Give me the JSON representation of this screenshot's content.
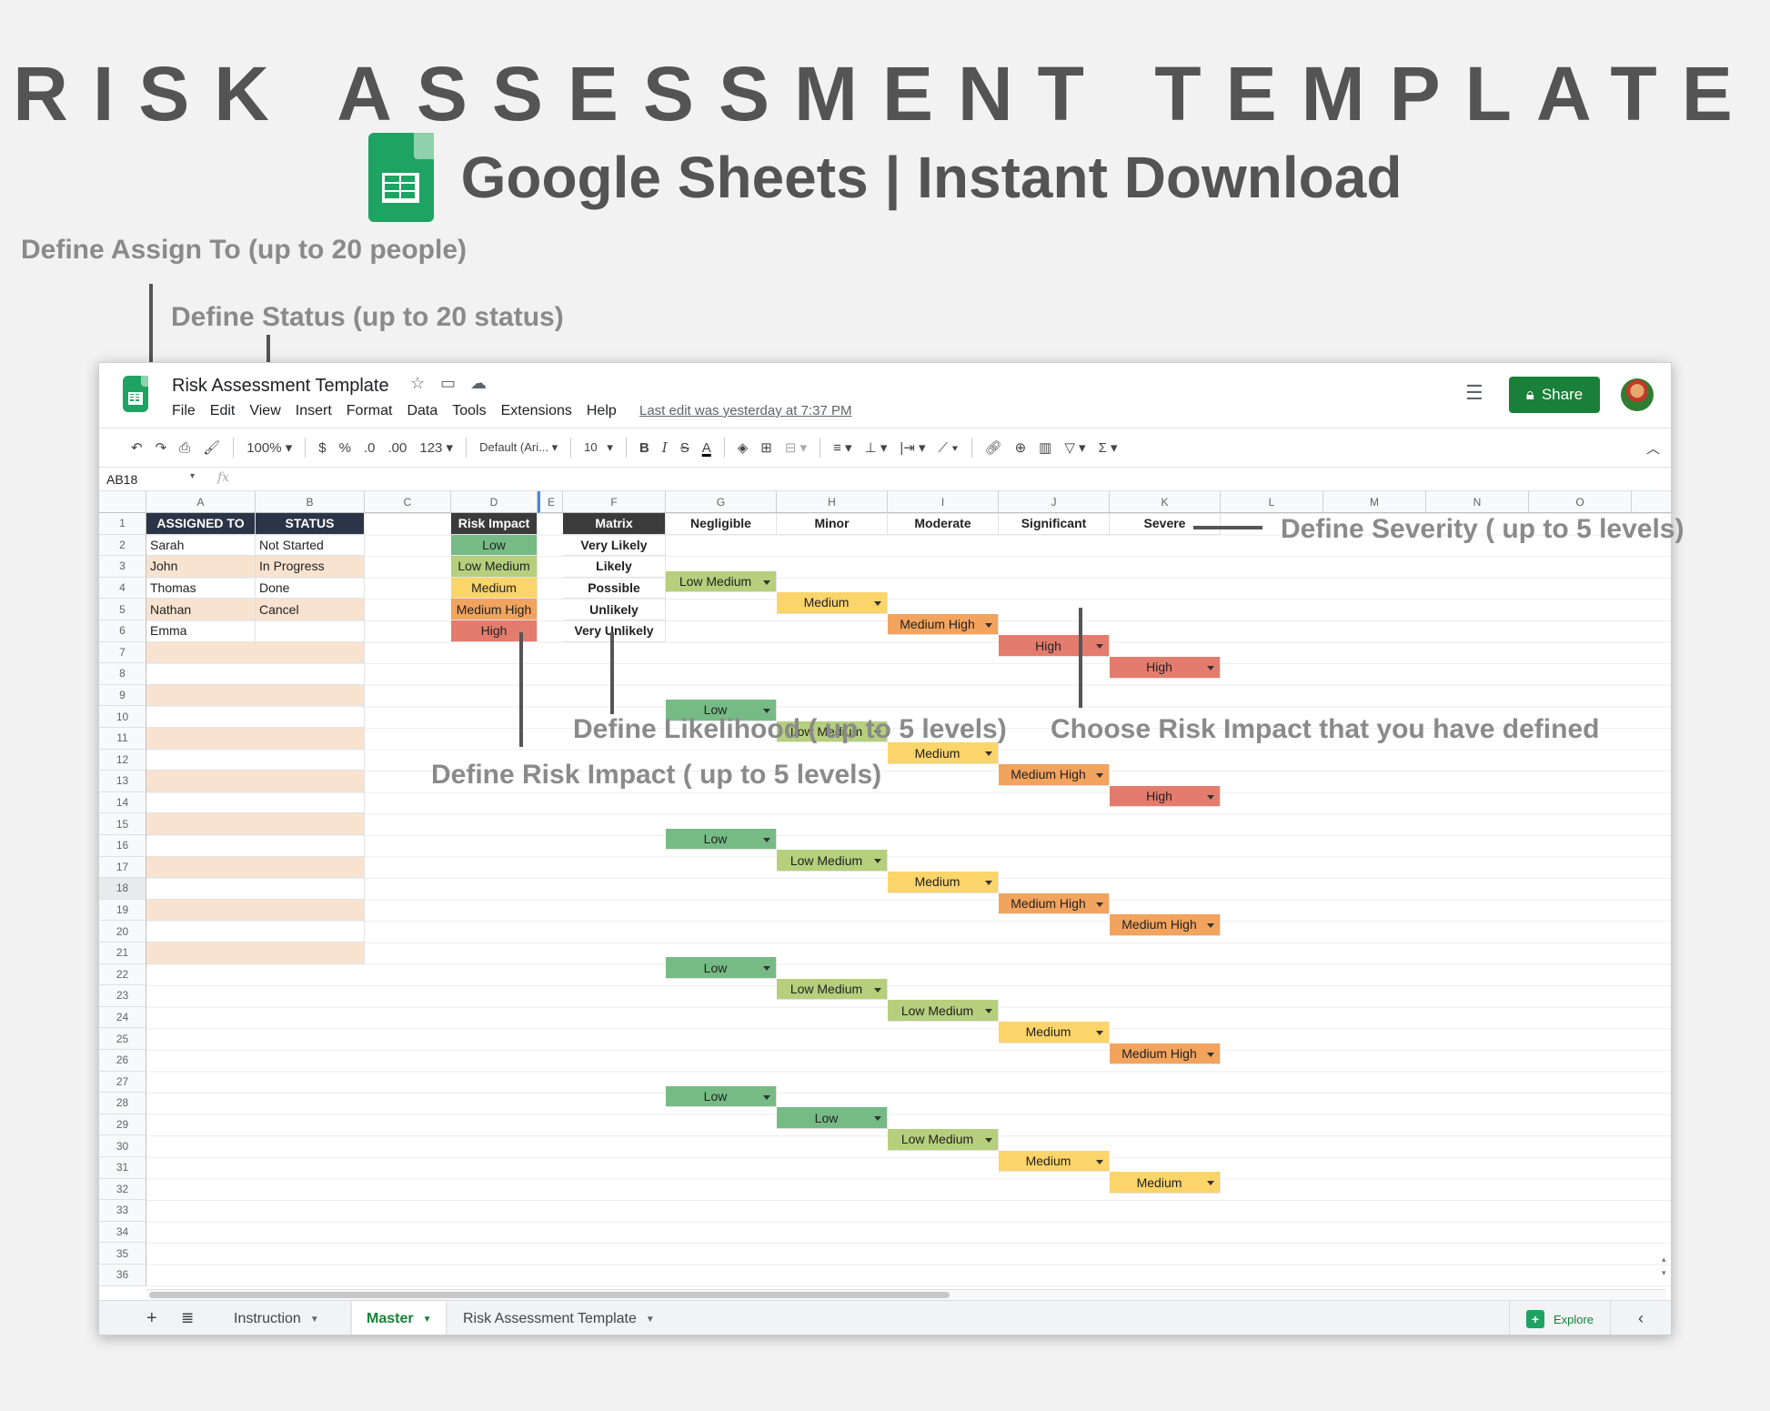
{
  "hero": {
    "title": "RISK ASSESSMENT TEMPLATE",
    "subtitle": "Google Sheets | Instant Download"
  },
  "annotations": {
    "assign_to": "Define Assign To (up to 20 people)",
    "status": "Define Status (up to 20 status)",
    "severity": "Define Severity ( up to 5 levels)",
    "likelihood": "Define Likelihood ( up to 5 levels)",
    "choose_impact": "Choose Risk Impact that you have defined",
    "risk_impact": "Define Risk Impact ( up to 5 levels)"
  },
  "app": {
    "doc_title": "Risk Assessment Template",
    "menu": [
      "File",
      "Edit",
      "View",
      "Insert",
      "Format",
      "Data",
      "Tools",
      "Extensions",
      "Help"
    ],
    "last_edit": "Last edit was yesterday at 7:37 PM",
    "share_label": "Share"
  },
  "toolbar": {
    "zoom": "100%",
    "currency": "$",
    "percent": "%",
    "dec_less": ".0",
    "dec_more": ".00",
    "format_num": "123",
    "font": "Default (Ari...",
    "font_size": "10",
    "bold": "B",
    "italic": "I",
    "strike": "S",
    "textcolor": "A"
  },
  "formula_bar": {
    "name_box": "AB18",
    "fx": "fx"
  },
  "columns": [
    "A",
    "B",
    "C",
    "D",
    "E",
    "F",
    "G",
    "H",
    "I",
    "J",
    "K",
    "L",
    "M",
    "N",
    "O"
  ],
  "rows": [
    "1",
    "2",
    "3",
    "4",
    "5",
    "6",
    "7",
    "8",
    "9",
    "10",
    "11",
    "12",
    "13",
    "14",
    "15",
    "16",
    "17",
    "18",
    "19",
    "20",
    "21",
    "22",
    "23",
    "24",
    "25",
    "26",
    "27",
    "28",
    "29",
    "30",
    "31",
    "32",
    "33",
    "34",
    "35",
    "36"
  ],
  "selected_row": "18",
  "people": {
    "header_assigned": "ASSIGNED TO",
    "header_status": "STATUS",
    "names": [
      "Sarah",
      "John",
      "Thomas",
      "Nathan",
      "Emma"
    ],
    "statuses": [
      "Not Started",
      "In Progress",
      "Done",
      "Cancel"
    ]
  },
  "risk_impact": {
    "header": "Risk Impact",
    "levels": [
      "Low",
      "Low Medium",
      "Medium",
      "Medium High",
      "High"
    ]
  },
  "matrix": {
    "header": "Matrix",
    "severity": [
      "Negligible",
      "Minor",
      "Moderate",
      "Significant",
      "Severe"
    ],
    "likelihood": [
      "Very Likely",
      "Likely",
      "Possible",
      "Unlikely",
      "Very Unlikely"
    ],
    "cells": [
      [
        "Low Medium",
        "Medium",
        "Medium High",
        "High",
        "High"
      ],
      [
        "Low",
        "Low Medium",
        "Medium",
        "Medium High",
        "High"
      ],
      [
        "Low",
        "Low Medium",
        "Medium",
        "Medium High",
        "Medium High"
      ],
      [
        "Low",
        "Low Medium",
        "Low Medium",
        "Medium",
        "Medium High"
      ],
      [
        "Low",
        "Low",
        "Low Medium",
        "Medium",
        "Medium"
      ]
    ]
  },
  "tabs": {
    "instruction": "Instruction",
    "master": "Master",
    "template": "Risk Assessment Template",
    "explore": "Explore"
  },
  "colors": {
    "Low": "#76bb85",
    "Low Medium": "#b5cf7c",
    "Medium": "#fbd46a",
    "Medium High": "#f2a35d",
    "High": "#e47c6e",
    "share": "#188038"
  }
}
